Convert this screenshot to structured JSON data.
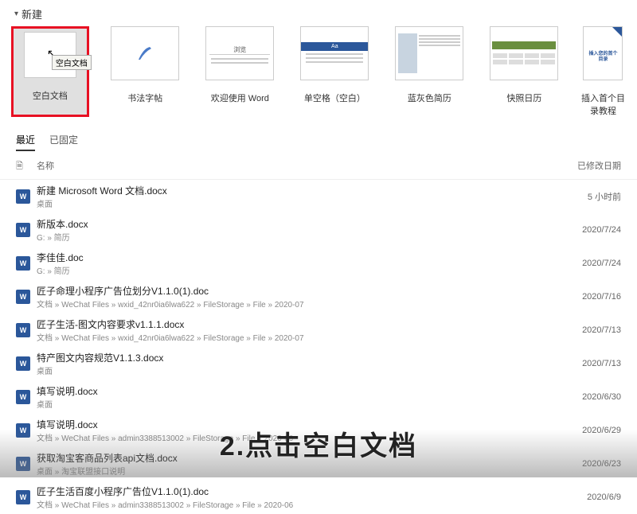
{
  "section": {
    "title": "新建"
  },
  "templates": [
    {
      "label": "空白文档",
      "tooltip": "空白文档",
      "selected": true
    },
    {
      "label": "书法字帖"
    },
    {
      "label": "欢迎使用 Word"
    },
    {
      "label": "单空格（空白）"
    },
    {
      "label": "蓝灰色简历"
    },
    {
      "label": "快照日历"
    },
    {
      "label": "插入首个目录教程"
    }
  ],
  "tabs": [
    {
      "label": "最近",
      "active": true
    },
    {
      "label": "已固定",
      "active": false
    }
  ],
  "list": {
    "name_header": "名称",
    "date_header": "已修改日期",
    "files": [
      {
        "name": "新建 Microsoft Word 文档.docx",
        "path": "桌面",
        "date": "5 小时前"
      },
      {
        "name": "新版本.docx",
        "path": "G: » 简历",
        "date": "2020/7/24"
      },
      {
        "name": "李佳佳.doc",
        "path": "G: » 简历",
        "date": "2020/7/24"
      },
      {
        "name": "匠子命理小程序广告位划分V1.1.0(1).doc",
        "path": "文档 » WeChat Files » wxid_42nr0ia6lwa622 » FileStorage » File » 2020-07",
        "date": "2020/7/16"
      },
      {
        "name": "匠子生活-图文内容要求v1.1.1.docx",
        "path": "文档 » WeChat Files » wxid_42nr0ia6lwa622 » FileStorage » File » 2020-07",
        "date": "2020/7/13"
      },
      {
        "name": "特产图文内容规范V1.1.3.docx",
        "path": "桌面",
        "date": "2020/7/13"
      },
      {
        "name": "填写说明.docx",
        "path": "桌面",
        "date": "2020/6/30"
      },
      {
        "name": "填写说明.docx",
        "path": "文档 » WeChat Files » admin3388513002 » FileStorage » File » 2020-06",
        "date": "2020/6/29"
      },
      {
        "name": "获取淘宝客商品列表api文档.docx",
        "path": "桌面 » 淘宝联盟接口说明",
        "date": "2020/6/23"
      },
      {
        "name": "匠子生活百度小程序广告位V1.1.0(1).doc",
        "path": "文档 » WeChat Files » admin3388513002 » FileStorage » File » 2020-06",
        "date": "2020/6/9"
      }
    ]
  },
  "overlay": {
    "instruction": "2.点击空白文档"
  }
}
